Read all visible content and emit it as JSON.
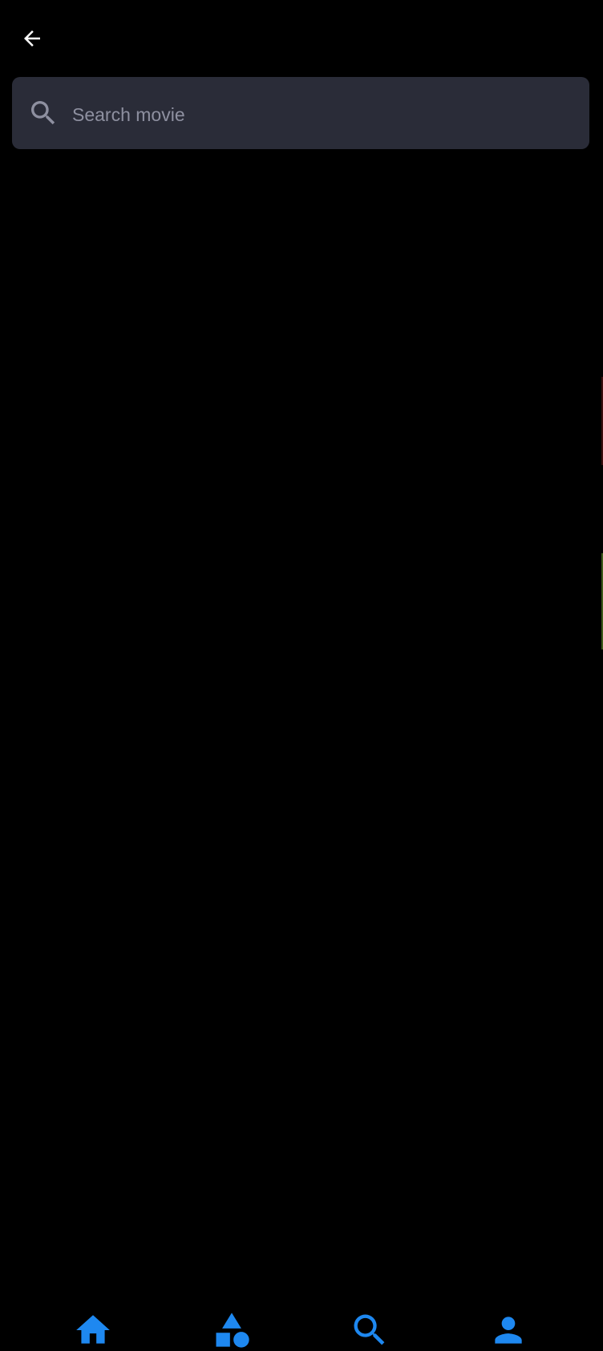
{
  "header": {
    "back_icon": "arrow-left-icon"
  },
  "search": {
    "icon": "search-icon",
    "placeholder": "Search movie",
    "value": ""
  },
  "bottom_nav": {
    "accent_color": "#1e88f0",
    "items": [
      {
        "icon": "home-icon"
      },
      {
        "icon": "category-shapes-icon"
      },
      {
        "icon": "search-icon"
      },
      {
        "icon": "person-icon"
      }
    ]
  },
  "colors": {
    "background": "#000000",
    "search_field": "#2a2c38",
    "placeholder": "#8e90a0",
    "icon_light": "#ffffff",
    "icon_muted": "#8e90a0",
    "accent": "#1e88f0"
  }
}
